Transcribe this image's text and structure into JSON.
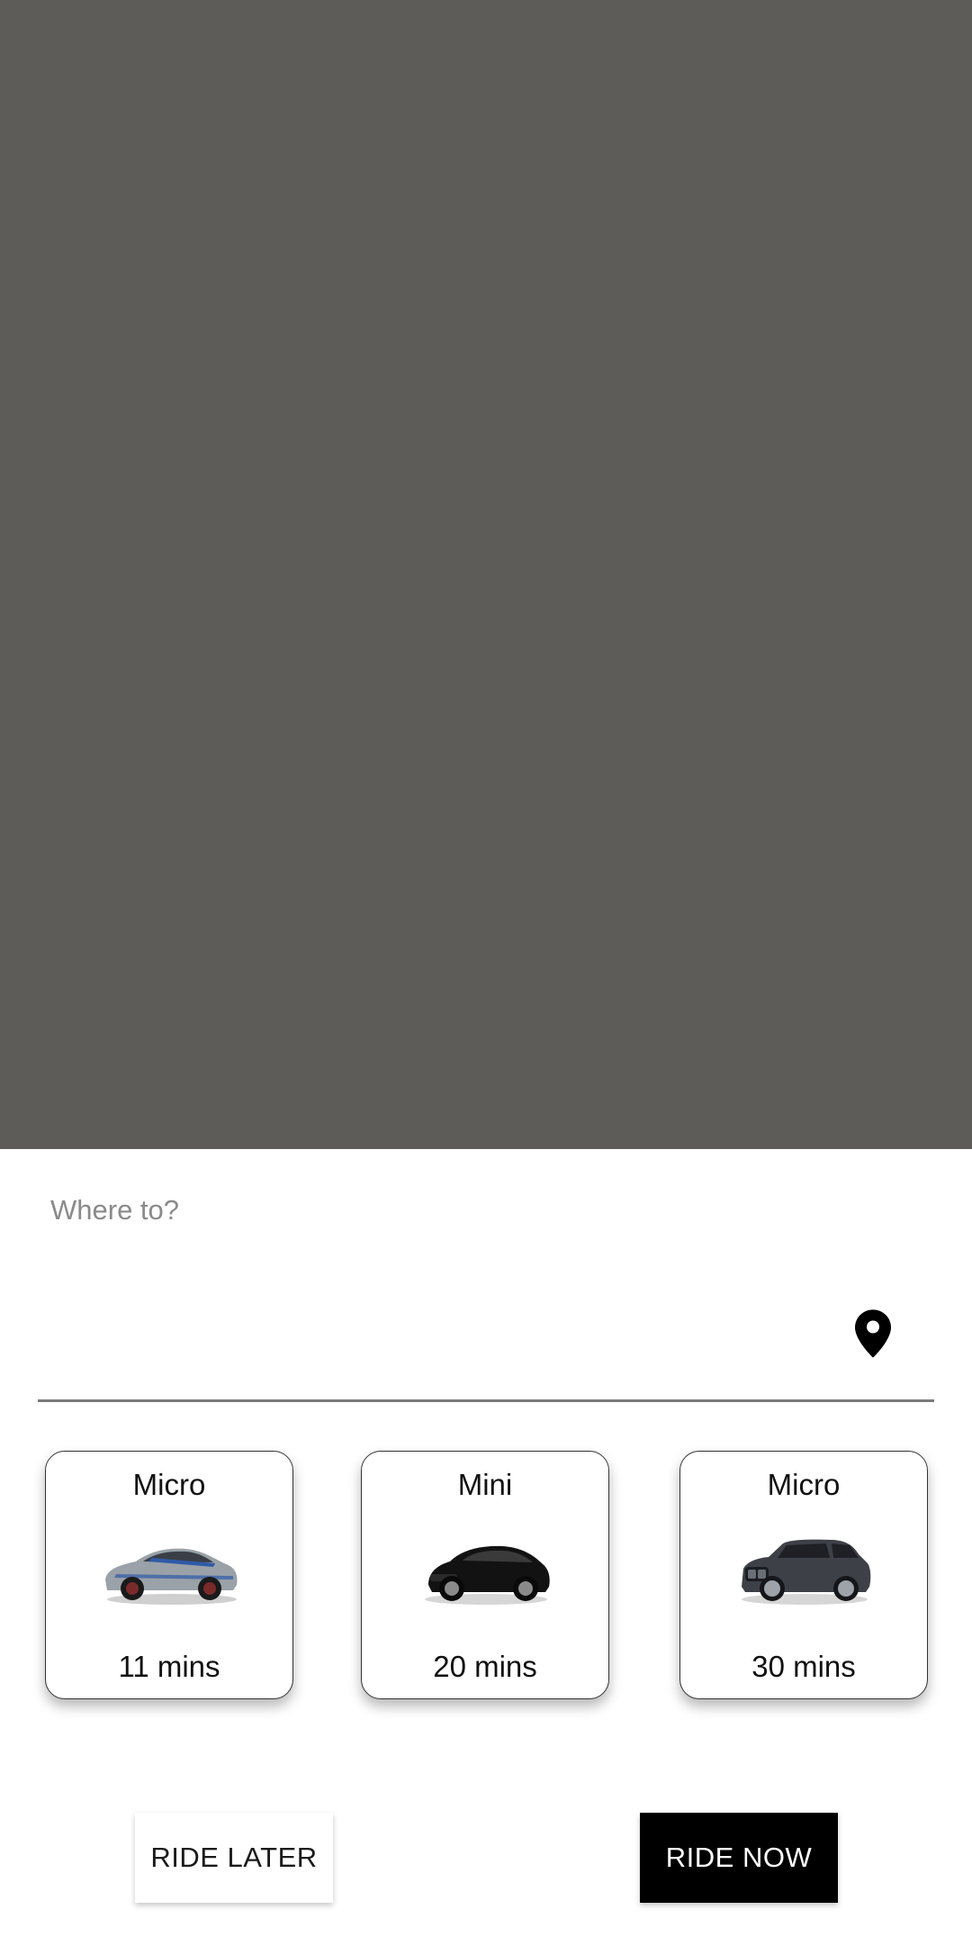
{
  "destination": {
    "label": "Where to?",
    "value": ""
  },
  "rides": [
    {
      "name": "Micro",
      "eta": "11 mins",
      "icon": "car-silver-coupe-icon"
    },
    {
      "name": "Mini",
      "eta": "20 mins",
      "icon": "car-black-suv-icon"
    },
    {
      "name": "Micro",
      "eta": "30 mins",
      "icon": "car-grey-suv-icon"
    }
  ],
  "actions": {
    "ride_later": "RIDE LATER",
    "ride_now": "RIDE NOW"
  },
  "colors": {
    "map_background": "#5e5c59",
    "primary_button": "#000000"
  }
}
